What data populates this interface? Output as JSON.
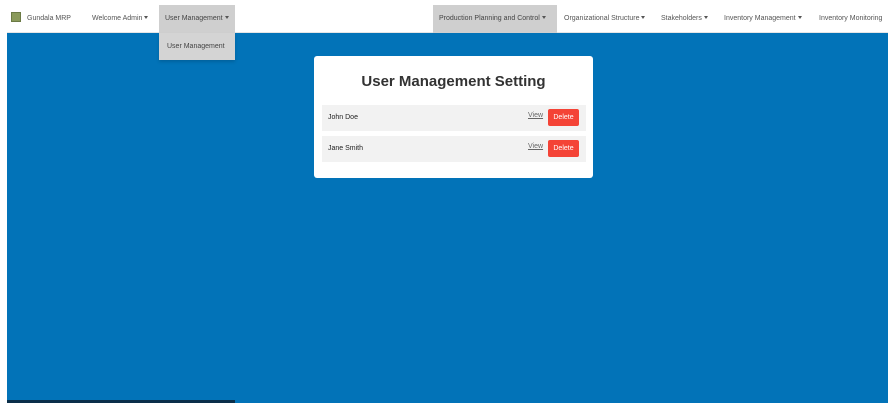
{
  "navbar": {
    "brand": "Gundala MRP",
    "welcome": "Welcome Admin",
    "user_management": "User Management",
    "production_planning": "Production Planning and Control",
    "organizational_structure": "Organizational Structure",
    "stakeholders": "Stakeholders",
    "inventory_management": "Inventory Management",
    "inventory_monitoring": "Inventory Monitoring"
  },
  "dropdown": {
    "items": [
      "User Management"
    ]
  },
  "card": {
    "title": "User Management Setting",
    "users": [
      {
        "name": "John Doe",
        "view_label": "View",
        "delete_label": "Delete"
      },
      {
        "name": "Jane Smith",
        "view_label": "View",
        "delete_label": "Delete"
      }
    ]
  },
  "colors": {
    "background": "#0273b8",
    "delete": "#f44336",
    "active_nav": "#cfcfcf"
  }
}
